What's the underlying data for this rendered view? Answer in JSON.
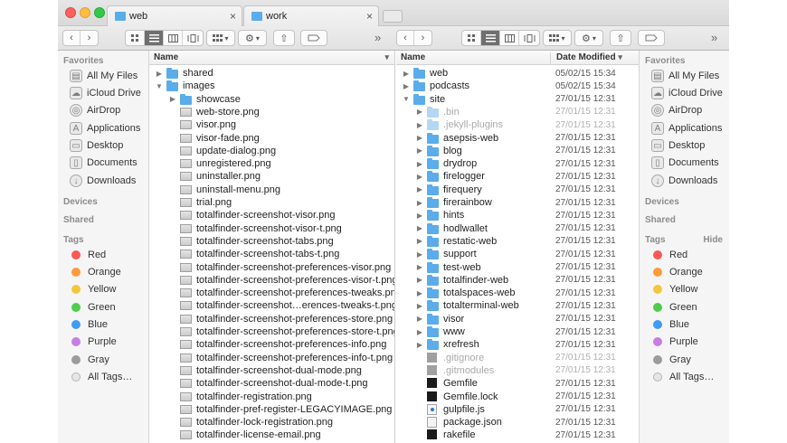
{
  "tabs": [
    {
      "label": "web",
      "close": "×"
    },
    {
      "label": "work",
      "close": "×"
    }
  ],
  "toolbar": {
    "back": "‹",
    "forward": "›",
    "more": "»",
    "gear": "⚙",
    "share": "⇧",
    "chevron": "▾"
  },
  "sidebar": {
    "favorites_header": "Favorites",
    "favorites": [
      {
        "label": "All My Files",
        "icon": "all-files-icon",
        "glyph": "▤"
      },
      {
        "label": "iCloud Drive",
        "icon": "icloud-icon",
        "glyph": "☁"
      },
      {
        "label": "AirDrop",
        "icon": "airdrop-icon",
        "glyph": "◎"
      },
      {
        "label": "Applications",
        "icon": "applications-icon",
        "glyph": "A"
      },
      {
        "label": "Desktop",
        "icon": "desktop-icon",
        "glyph": "▭"
      },
      {
        "label": "Documents",
        "icon": "documents-icon",
        "glyph": "▯"
      },
      {
        "label": "Downloads",
        "icon": "downloads-icon",
        "glyph": "↓"
      }
    ],
    "devices_header": "Devices",
    "shared_header": "Shared",
    "tags_header": "Tags",
    "hide_label": "Hide",
    "tags": [
      {
        "label": "Red",
        "color": "#fc5753"
      },
      {
        "label": "Orange",
        "color": "#fd9a3b"
      },
      {
        "label": "Yellow",
        "color": "#f3c73a"
      },
      {
        "label": "Green",
        "color": "#4fcd4a"
      },
      {
        "label": "Blue",
        "color": "#3f9cf5"
      },
      {
        "label": "Purple",
        "color": "#c77de6"
      },
      {
        "label": "Gray",
        "color": "#9c9c9c"
      },
      {
        "label": "All Tags…",
        "color": "#e6e6e6"
      }
    ]
  },
  "left_pane": {
    "column_name": "Name",
    "sort_arrow": "▾",
    "rows": [
      {
        "name": "shared",
        "kind": "folder",
        "depth": 0,
        "disc": "▶"
      },
      {
        "name": "images",
        "kind": "folder",
        "depth": 0,
        "disc": "▼"
      },
      {
        "name": "showcase",
        "kind": "folder",
        "depth": 1,
        "disc": "▶"
      },
      {
        "name": "web-store.png",
        "kind": "image",
        "depth": 1,
        "disc": ""
      },
      {
        "name": "visor.png",
        "kind": "image",
        "depth": 1,
        "disc": ""
      },
      {
        "name": "visor-fade.png",
        "kind": "image",
        "depth": 1,
        "disc": ""
      },
      {
        "name": "update-dialog.png",
        "kind": "image",
        "depth": 1,
        "disc": ""
      },
      {
        "name": "unregistered.png",
        "kind": "image",
        "depth": 1,
        "disc": ""
      },
      {
        "name": "uninstaller.png",
        "kind": "image",
        "depth": 1,
        "disc": ""
      },
      {
        "name": "uninstall-menu.png",
        "kind": "image",
        "depth": 1,
        "disc": ""
      },
      {
        "name": "trial.png",
        "kind": "image",
        "depth": 1,
        "disc": ""
      },
      {
        "name": "totalfinder-screenshot-visor.png",
        "kind": "image",
        "depth": 1,
        "disc": ""
      },
      {
        "name": "totalfinder-screenshot-visor-t.png",
        "kind": "image",
        "depth": 1,
        "disc": ""
      },
      {
        "name": "totalfinder-screenshot-tabs.png",
        "kind": "image",
        "depth": 1,
        "disc": ""
      },
      {
        "name": "totalfinder-screenshot-tabs-t.png",
        "kind": "image",
        "depth": 1,
        "disc": ""
      },
      {
        "name": "totalfinder-screenshot-preferences-visor.png",
        "kind": "image",
        "depth": 1,
        "disc": ""
      },
      {
        "name": "totalfinder-screenshot-preferences-visor-t.png",
        "kind": "image",
        "depth": 1,
        "disc": ""
      },
      {
        "name": "totalfinder-screenshot-preferences-tweaks.png",
        "kind": "image",
        "depth": 1,
        "disc": ""
      },
      {
        "name": "totalfinder-screenshot…erences-tweaks-t.png",
        "kind": "image",
        "depth": 1,
        "disc": ""
      },
      {
        "name": "totalfinder-screenshot-preferences-store.png",
        "kind": "image",
        "depth": 1,
        "disc": ""
      },
      {
        "name": "totalfinder-screenshot-preferences-store-t.png",
        "kind": "image",
        "depth": 1,
        "disc": ""
      },
      {
        "name": "totalfinder-screenshot-preferences-info.png",
        "kind": "image",
        "depth": 1,
        "disc": ""
      },
      {
        "name": "totalfinder-screenshot-preferences-info-t.png",
        "kind": "image",
        "depth": 1,
        "disc": ""
      },
      {
        "name": "totalfinder-screenshot-dual-mode.png",
        "kind": "image",
        "depth": 1,
        "disc": ""
      },
      {
        "name": "totalfinder-screenshot-dual-mode-t.png",
        "kind": "image",
        "depth": 1,
        "disc": ""
      },
      {
        "name": "totalfinder-registration.png",
        "kind": "image",
        "depth": 1,
        "disc": ""
      },
      {
        "name": "totalfinder-pref-register-LEGACYIMAGE.png",
        "kind": "image",
        "depth": 1,
        "disc": ""
      },
      {
        "name": "totalfinder-lock-registration.png",
        "kind": "image",
        "depth": 1,
        "disc": ""
      },
      {
        "name": "totalfinder-license-email.png",
        "kind": "image",
        "depth": 1,
        "disc": ""
      }
    ]
  },
  "right_pane": {
    "column_name": "Name",
    "column_date": "Date Modified",
    "sort_arrow": "▾",
    "rows": [
      {
        "name": "web",
        "kind": "folder",
        "depth": 0,
        "disc": "▶",
        "date": "05/02/15 15:34",
        "dim": false
      },
      {
        "name": "podcasts",
        "kind": "folder",
        "depth": 0,
        "disc": "▶",
        "date": "05/02/15 15:34",
        "dim": false
      },
      {
        "name": "site",
        "kind": "folder",
        "depth": 0,
        "disc": "▼",
        "date": "27/01/15 12:31",
        "dim": false
      },
      {
        "name": ".bin",
        "kind": "folder",
        "depth": 1,
        "disc": "▶",
        "date": "27/01/15 12:31",
        "dim": true
      },
      {
        "name": ".jekyll-plugins",
        "kind": "folder",
        "depth": 1,
        "disc": "▶",
        "date": "27/01/15 12:31",
        "dim": true
      },
      {
        "name": "asepsis-web",
        "kind": "folder",
        "depth": 1,
        "disc": "▶",
        "date": "27/01/15 12:31",
        "dim": false
      },
      {
        "name": "blog",
        "kind": "folder",
        "depth": 1,
        "disc": "▶",
        "date": "27/01/15 12:31",
        "dim": false
      },
      {
        "name": "drydrop",
        "kind": "folder",
        "depth": 1,
        "disc": "▶",
        "date": "27/01/15 12:31",
        "dim": false
      },
      {
        "name": "firelogger",
        "kind": "folder",
        "depth": 1,
        "disc": "▶",
        "date": "27/01/15 12:31",
        "dim": false
      },
      {
        "name": "firequery",
        "kind": "folder",
        "depth": 1,
        "disc": "▶",
        "date": "27/01/15 12:31",
        "dim": false
      },
      {
        "name": "firerainbow",
        "kind": "folder",
        "depth": 1,
        "disc": "▶",
        "date": "27/01/15 12:31",
        "dim": false
      },
      {
        "name": "hints",
        "kind": "folder",
        "depth": 1,
        "disc": "▶",
        "date": "27/01/15 12:31",
        "dim": false
      },
      {
        "name": "hodlwallet",
        "kind": "folder",
        "depth": 1,
        "disc": "▶",
        "date": "27/01/15 12:31",
        "dim": false
      },
      {
        "name": "restatic-web",
        "kind": "folder",
        "depth": 1,
        "disc": "▶",
        "date": "27/01/15 12:31",
        "dim": false
      },
      {
        "name": "support",
        "kind": "folder",
        "depth": 1,
        "disc": "▶",
        "date": "27/01/15 12:31",
        "dim": false
      },
      {
        "name": "test-web",
        "kind": "folder",
        "depth": 1,
        "disc": "▶",
        "date": "27/01/15 12:31",
        "dim": false
      },
      {
        "name": "totalfinder-web",
        "kind": "folder",
        "depth": 1,
        "disc": "▶",
        "date": "27/01/15 12:31",
        "dim": false
      },
      {
        "name": "totalspaces-web",
        "kind": "folder",
        "depth": 1,
        "disc": "▶",
        "date": "27/01/15 12:31",
        "dim": false
      },
      {
        "name": "totalterminal-web",
        "kind": "folder",
        "depth": 1,
        "disc": "▶",
        "date": "27/01/15 12:31",
        "dim": false
      },
      {
        "name": "visor",
        "kind": "folder",
        "depth": 1,
        "disc": "▶",
        "date": "27/01/15 12:31",
        "dim": false
      },
      {
        "name": "www",
        "kind": "folder",
        "depth": 1,
        "disc": "▶",
        "date": "27/01/15 12:31",
        "dim": false
      },
      {
        "name": "xrefresh",
        "kind": "folder",
        "depth": 1,
        "disc": "▶",
        "date": "27/01/15 12:31",
        "dim": false
      },
      {
        "name": ".gitignore",
        "kind": "gray",
        "depth": 1,
        "disc": "",
        "date": "27/01/15 12:31",
        "dim": true
      },
      {
        "name": ".gitmodules",
        "kind": "gray",
        "depth": 1,
        "disc": "",
        "date": "27/01/15 12:31",
        "dim": true
      },
      {
        "name": "Gemfile",
        "kind": "black",
        "depth": 1,
        "disc": "",
        "date": "27/01/15 12:31",
        "dim": false
      },
      {
        "name": "Gemfile.lock",
        "kind": "black",
        "depth": 1,
        "disc": "",
        "date": "27/01/15 12:31",
        "dim": false
      },
      {
        "name": "gulpfile.js",
        "kind": "js",
        "depth": 1,
        "disc": "",
        "date": "27/01/15 12:31",
        "dim": false
      },
      {
        "name": "package.json",
        "kind": "file",
        "depth": 1,
        "disc": "",
        "date": "27/01/15 12:31",
        "dim": false
      },
      {
        "name": "rakefile",
        "kind": "black",
        "depth": 1,
        "disc": "",
        "date": "27/01/15 12:31",
        "dim": false
      }
    ]
  }
}
